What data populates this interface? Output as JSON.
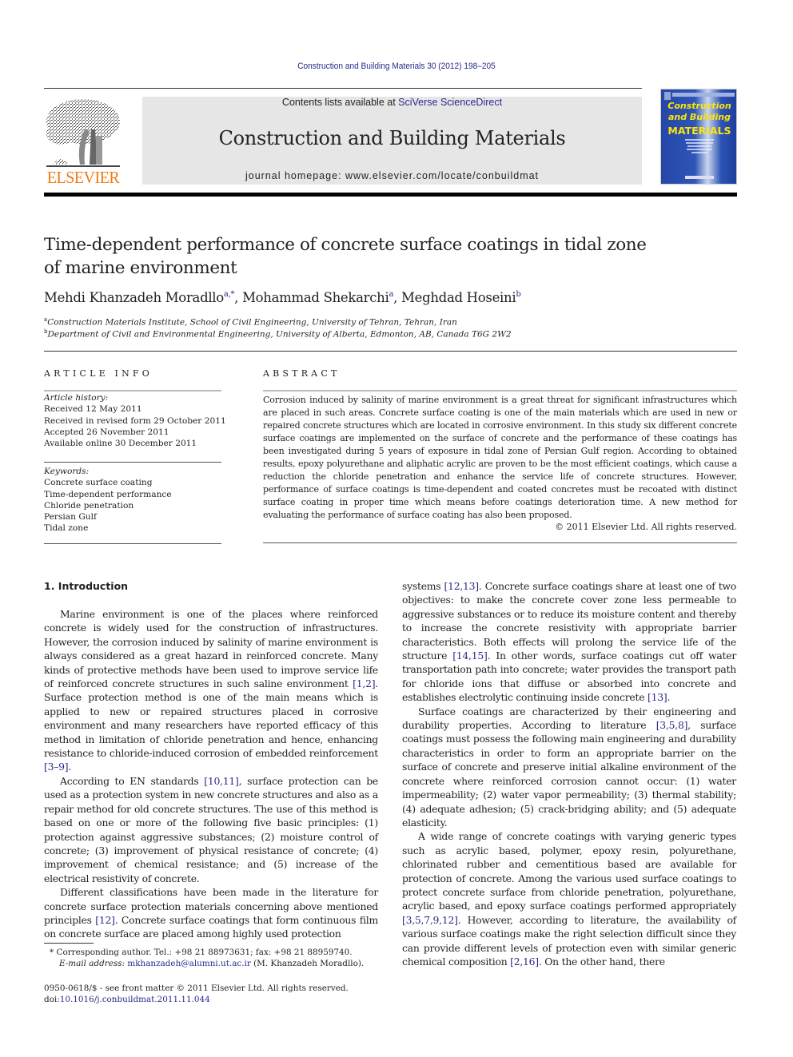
{
  "running_header": "Construction and Building Materials 30 (2012) 198–205",
  "masthead": {
    "publisher_wordmark": "ELSEVIER",
    "contents_prefix": "Contents lists available at ",
    "contents_link": "SciVerse ScienceDirect",
    "journal_title": "Construction and Building Materials",
    "homepage": "journal homepage: www.elsevier.com/locate/conbuildmat",
    "cover": {
      "line1": "Construction",
      "line2": "and Building",
      "line3": "MATERIALS"
    }
  },
  "colors": {
    "link": "#2a2a8c",
    "elsevier_orange": "#f07a13",
    "masthead_bg": "#e6e6e6",
    "cover_blue": "#2546a8",
    "cover_yellow": "#ffe600"
  },
  "article": {
    "title_line1": "Time-dependent performance of concrete surface coatings in tidal zone",
    "title_line2": "of marine environment",
    "authors": [
      {
        "name": "Mehdi Khanzadeh Moradllo",
        "sup": "a,*"
      },
      {
        "name": "Mohammad Shekarchi",
        "sup": "a"
      },
      {
        "name": "Meghdad Hoseini",
        "sup": "b"
      }
    ],
    "affiliations": [
      {
        "mark": "a",
        "text": "Construction Materials Institute, School of Civil Engineering, University of Tehran, Tehran, Iran"
      },
      {
        "mark": "b",
        "text": "Department of Civil and Environmental Engineering, University of Alberta, Edmonton, AB, Canada T6G 2W2"
      }
    ]
  },
  "article_info": {
    "heading": "ARTICLE INFO",
    "history_label": "Article history:",
    "history": [
      "Received 12 May 2011",
      "Received in revised form 29 October 2011",
      "Accepted 26 November 2011",
      "Available online 30 December 2011"
    ],
    "keywords_label": "Keywords:",
    "keywords": [
      "Concrete surface coating",
      "Time-dependent performance",
      "Chloride penetration",
      "Persian Gulf",
      "Tidal zone"
    ]
  },
  "abstract": {
    "heading": "ABSTRACT",
    "text": "Corrosion induced by salinity of marine environment is a great threat for significant infrastructures which are placed in such areas. Concrete surface coating is one of the main materials which are used in new or repaired concrete structures which are located in corrosive environment. In this study six different concrete surface coatings are implemented on the surface of concrete and the performance of these coatings has been investigated during 5 years of exposure in tidal zone of Persian Gulf region. According to obtained results, epoxy polyurethane and aliphatic acrylic are proven to be the most efficient coatings, which cause a reduction the chloride penetration and enhance the service life of concrete structures. However, performance of surface coatings is time-dependent and coated concretes must be recoated with distinct surface coating in proper time which means before coatings deterioration time. A new method for evaluating the performance of surface coating has also been proposed.",
    "copyright": "© 2011 Elsevier Ltd. All rights reserved."
  },
  "body": {
    "section_heading": "1. Introduction",
    "left_paragraphs": [
      [
        {
          "t": "Marine environment is one of the places where reinforced concrete is widely used for the construction of infrastructures. However, the corrosion induced by salinity of marine environment is always considered as a great hazard in reinforced concrete. Many kinds of protective methods have been used to improve service life of reinforced concrete structures in such saline environment "
        },
        {
          "ref": "[1,2]"
        },
        {
          "t": ". Surface protection method is one of the main means which is applied to new or repaired structures placed in corrosive environment and many researchers have reported efficacy of this method in limitation of chloride penetration and hence, enhancing resistance to chloride-induced corrosion of embedded reinforcement "
        },
        {
          "ref": "[3–9]"
        },
        {
          "t": "."
        }
      ],
      [
        {
          "t": "According to EN standards "
        },
        {
          "ref": "[10,11]"
        },
        {
          "t": ", surface protection can be used as a protection system in new concrete structures and also as a repair method for old concrete structures. The use of this method is based on one or more of the following five basic principles: (1) protection against aggressive substances; (2) moisture control of concrete; (3) improvement of physical resistance of concrete; (4) improvement of chemical resistance; and (5) increase of the electrical resistivity of concrete."
        }
      ],
      [
        {
          "t": "Different classifications have been made in the literature for concrete surface protection materials concerning above mentioned principles "
        },
        {
          "ref": "[12]"
        },
        {
          "t": ". Concrete surface coatings that form continuous film on concrete surface are placed among highly used protection"
        }
      ]
    ],
    "right_paragraphs": [
      [
        {
          "t": "systems "
        },
        {
          "ref": "[12,13]"
        },
        {
          "t": ". Concrete surface coatings share at least one of two objectives: to make the concrete cover zone less permeable to aggressive substances or to reduce its moisture content and thereby to increase the concrete resistivity with appropriate barrier characteristics. Both effects will prolong the service life of the structure "
        },
        {
          "ref": "[14,15]"
        },
        {
          "t": ". In other words, surface coatings cut off water transportation path into concrete; water provides the transport path for chloride ions that diffuse or absorbed into concrete and establishes electrolytic continuing inside concrete "
        },
        {
          "ref": "[13]"
        },
        {
          "t": "."
        }
      ],
      [
        {
          "t": "Surface coatings are characterized by their engineering and durability properties. According to literature "
        },
        {
          "ref": "[3,5,8]"
        },
        {
          "t": ", surface coatings must possess the following main engineering and durability characteristics in order to form an appropriate barrier on the surface of concrete and preserve initial alkaline environment of the concrete where reinforced corrosion cannot occur: (1) water impermeability; (2) water vapor permeability; (3) thermal stability; (4) adequate adhesion; (5) crack-bridging ability; and (5) adequate elasticity."
        }
      ],
      [
        {
          "t": "A wide range of concrete coatings with varying generic types such as acrylic based, polymer, epoxy resin, polyurethane, chlorinated rubber and cementitious based are available for protection of concrete. Among the various used surface coatings to protect concrete surface from chloride penetration, polyurethane, acrylic based, and epoxy surface coatings performed appropriately "
        },
        {
          "ref": "[3,5,7,9,12]"
        },
        {
          "t": ". However, according to literature, the availability of various surface coatings make the right selection difficult since they can provide different levels of protection even with similar generic chemical composition "
        },
        {
          "ref": "[2,16]"
        },
        {
          "t": ". On the other hand, there"
        }
      ]
    ]
  },
  "footnotes": {
    "corresponding": "* Corresponding author. Tel.: +98 21 88973631; fax: +98 21 88959740.",
    "email_label": "E-mail address: ",
    "email": "mkhanzadeh@alumni.ut.ac.ir",
    "email_suffix": " (M. Khanzadeh Moradllo).",
    "front_matter": "0950-0618/$ - see front matter © 2011 Elsevier Ltd. All rights reserved.",
    "doi_prefix": "doi:",
    "doi": "10.1016/j.conbuildmat.2011.11.044"
  }
}
